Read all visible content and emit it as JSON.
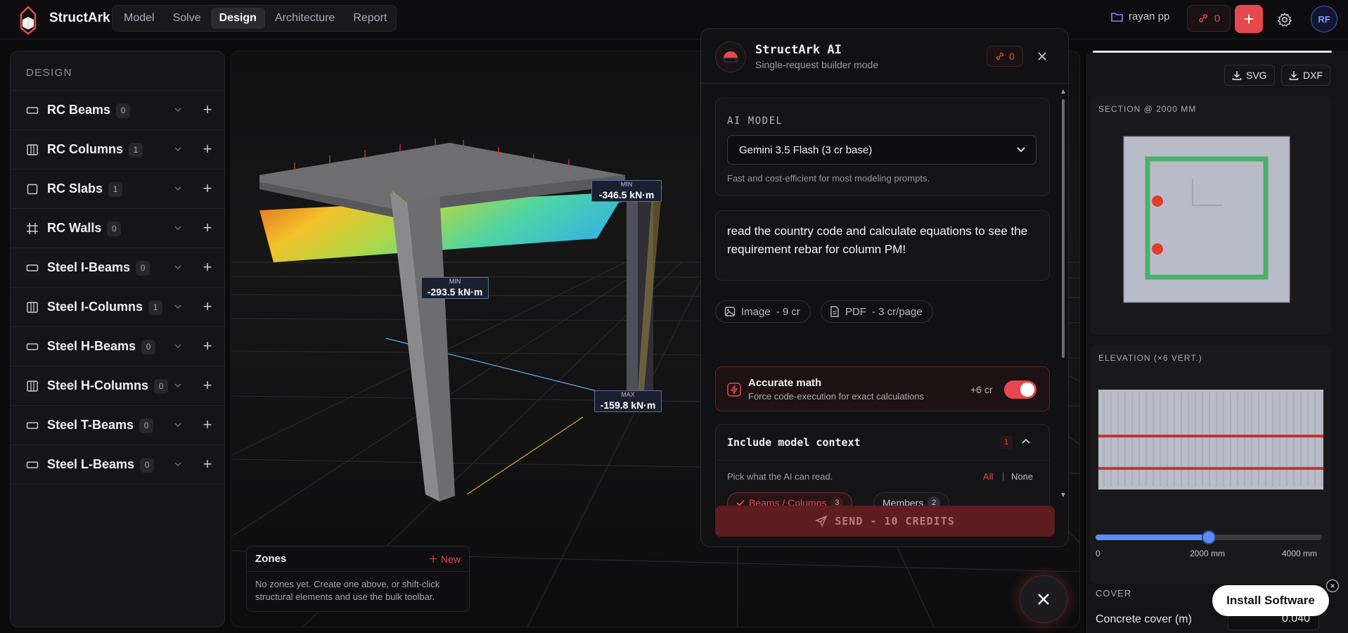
{
  "app": {
    "name": "StructArk"
  },
  "nav": {
    "tabs": [
      "Model",
      "Solve",
      "Design",
      "Architecture",
      "Report"
    ],
    "active": "Design"
  },
  "header": {
    "user": "rayan pp",
    "credits": "0",
    "add_label": "+",
    "avatar_initials": "RF"
  },
  "sidebar": {
    "title": "DESIGN",
    "items": [
      {
        "label": "RC Beams",
        "count": "0",
        "icon": "beam-icon"
      },
      {
        "label": "RC Columns",
        "count": "1",
        "icon": "column-icon"
      },
      {
        "label": "RC Slabs",
        "count": "1",
        "icon": "slab-icon"
      },
      {
        "label": "RC Walls",
        "count": "0",
        "icon": "wall-grid-icon"
      },
      {
        "label": "Steel I-Beams",
        "count": "0",
        "icon": "beam-icon"
      },
      {
        "label": "Steel I-Columns",
        "count": "1",
        "icon": "column-icon"
      },
      {
        "label": "Steel H-Beams",
        "count": "0",
        "icon": "beam-icon"
      },
      {
        "label": "Steel H-Columns",
        "count": "0",
        "icon": "column-icon"
      },
      {
        "label": "Steel T-Beams",
        "count": "0",
        "icon": "beam-icon"
      },
      {
        "label": "Steel L-Beams",
        "count": "0",
        "icon": "beam-icon"
      }
    ]
  },
  "viewport": {
    "moment_labels": [
      {
        "kind": "MIN",
        "value": "-346.5 kN·m"
      },
      {
        "kind": "MIN",
        "value": "-293.5 kN·m"
      },
      {
        "kind": "MAX",
        "value": "-159.8 kN·m"
      }
    ],
    "zones": {
      "title": "Zones",
      "new_label": "New",
      "empty_text": "No zones yet. Create one above, or shift-click structural elements and use the bulk toolbar."
    }
  },
  "ai_panel": {
    "title": "StructArk AI",
    "subtitle": "Single-request builder mode",
    "credits": "0",
    "model_label": "AI MODEL",
    "model_value": "Gemini 3.5 Flash (3 cr base)",
    "model_hint": "Fast and cost-efficient for most modeling prompts.",
    "prompt": "read the country code and calculate equations to see the requirement rebar for  column PM!",
    "attach_image": "Image",
    "attach_image_cost": "- 9 cr",
    "attach_pdf": "PDF",
    "attach_pdf_cost": "- 3 cr/page",
    "accurate_title": "Accurate math",
    "accurate_sub": "Force code-execution for exact calculations",
    "accurate_cost": "+6 cr",
    "accurate_on": true,
    "context_title": "Include model context",
    "context_count": "1",
    "context_question": "Pick what the AI can read.",
    "context_all": "All",
    "context_sep": "|",
    "context_none": "None",
    "chips": [
      {
        "label": "Beams / Columns",
        "count": "3",
        "selected": true
      },
      {
        "label": "Members",
        "count": "2",
        "selected": false
      }
    ],
    "send_label": "SEND - 10 CREDITS"
  },
  "right_panel": {
    "export_svg": "SVG",
    "export_dxf": "DXF",
    "section_title": "SECTION @ 2000 MM",
    "elevation_title": "ELEVATION (×6 VERT.)",
    "slider_value_fraction": 0.5,
    "slider_min": "0",
    "slider_mid": "2000 mm",
    "slider_max": "4000 mm",
    "cover_title": "COVER",
    "cover_label": "Concrete cover (m)",
    "cover_value": "0.040"
  },
  "install": {
    "label": "Install Software",
    "close": "×"
  },
  "colors": {
    "accent": "#e5484d",
    "slider": "#5b8cff",
    "rebar": "#4caf6a"
  }
}
